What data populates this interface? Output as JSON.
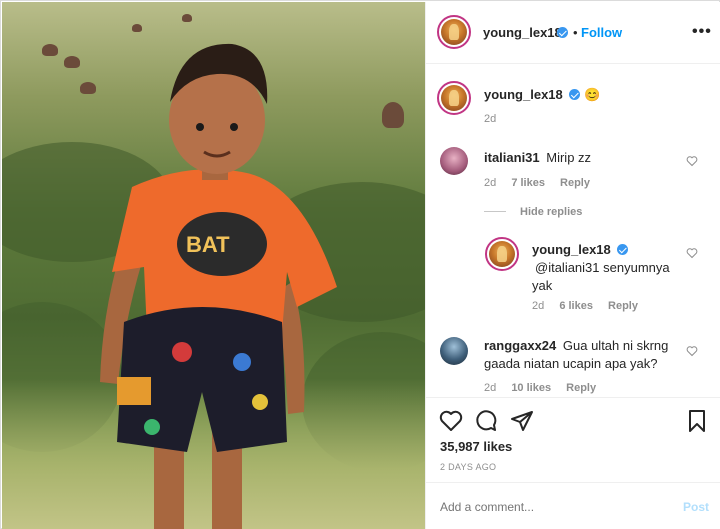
{
  "post": {
    "author": "young_lex18",
    "follow_label": "Follow",
    "dot": "•",
    "more_label": "•••"
  },
  "caption": {
    "user": "young_lex18",
    "emoji": "😊",
    "age": "2d"
  },
  "comments": [
    {
      "user": "italiani31",
      "text": "Mirip zz",
      "age": "2d",
      "likes": "7 likes",
      "reply": "Reply"
    },
    {
      "user": "young_lex18",
      "text": "@italiani31 senyumnya yak",
      "age": "2d",
      "likes": "6 likes",
      "reply": "Reply"
    },
    {
      "user": "ranggaxx24",
      "text": "Gua ultah ni skrng gaada niatan ucapin apa yak?",
      "age": "2d",
      "likes": "10 likes",
      "reply": "Reply"
    }
  ],
  "hide_replies": "Hide replies",
  "stats": {
    "likes": "35,987 likes",
    "date": "2 DAYS AGO"
  },
  "add_comment": {
    "placeholder": "Add a comment...",
    "post_label": "Post"
  },
  "colors": {
    "accent": "#0095f6",
    "verified": "#3897f0",
    "muted": "#8e8e8e",
    "post_disabled": "#b2dffc"
  },
  "icons": [
    "heart-icon",
    "comment-icon",
    "share-icon",
    "bookmark-icon",
    "verified-icon",
    "more-icon"
  ]
}
